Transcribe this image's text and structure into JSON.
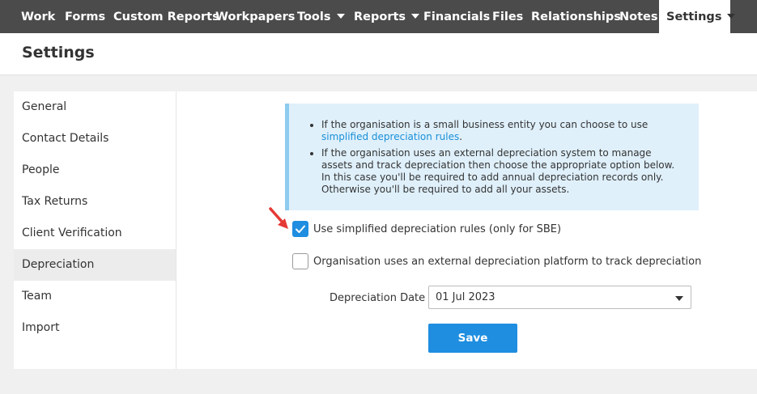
{
  "topnav": {
    "items": [
      {
        "label": "Work"
      },
      {
        "label": "Forms"
      },
      {
        "label": "Custom Reports"
      },
      {
        "label": "Workpapers"
      },
      {
        "label": "Tools"
      },
      {
        "label": "Reports"
      },
      {
        "label": "Financials"
      },
      {
        "label": "Files"
      },
      {
        "label": "Relationships"
      },
      {
        "label": "Notes"
      },
      {
        "label": "Settings"
      }
    ],
    "active": "Settings"
  },
  "page": {
    "title": "Settings"
  },
  "sidebar": {
    "items": [
      {
        "label": "General"
      },
      {
        "label": "Contact Details"
      },
      {
        "label": "People"
      },
      {
        "label": "Tax Returns"
      },
      {
        "label": "Client Verification"
      },
      {
        "label": "Depreciation"
      },
      {
        "label": "Team"
      },
      {
        "label": "Import"
      }
    ],
    "active": "Depreciation"
  },
  "info": {
    "bullet1_text": "If the organisation is a small business entity you can choose to use",
    "bullet1_link": "simplified depreciation rules",
    "bullet1_end": ".",
    "bullet2": "If the organisation uses an external depreciation system to manage assets and track depreciation then choose the appropriate option below. In this case you'll be required to add annual depreciation records only. Otherwise you'll be required to add all your assets."
  },
  "options": {
    "simplified": {
      "label": "Use simplified depreciation rules (only for SBE)",
      "checked": true
    },
    "external": {
      "label": "Organisation uses an external depreciation platform to track depreciation",
      "checked": false
    }
  },
  "depreciation_date": {
    "label": "Depreciation Date",
    "value": "01 Jul 2023"
  },
  "actions": {
    "save_label": "Save"
  },
  "colors": {
    "nav_bg": "#4b4b4b",
    "accent": "#1f8ee0",
    "info_bg": "#dff0fb",
    "info_border": "#8ecbf1",
    "arrow": "#e53935"
  },
  "icons": {
    "checkmark": "check-icon",
    "pointer": "red-arrow-icon",
    "dropdown": "caret-down-icon"
  }
}
